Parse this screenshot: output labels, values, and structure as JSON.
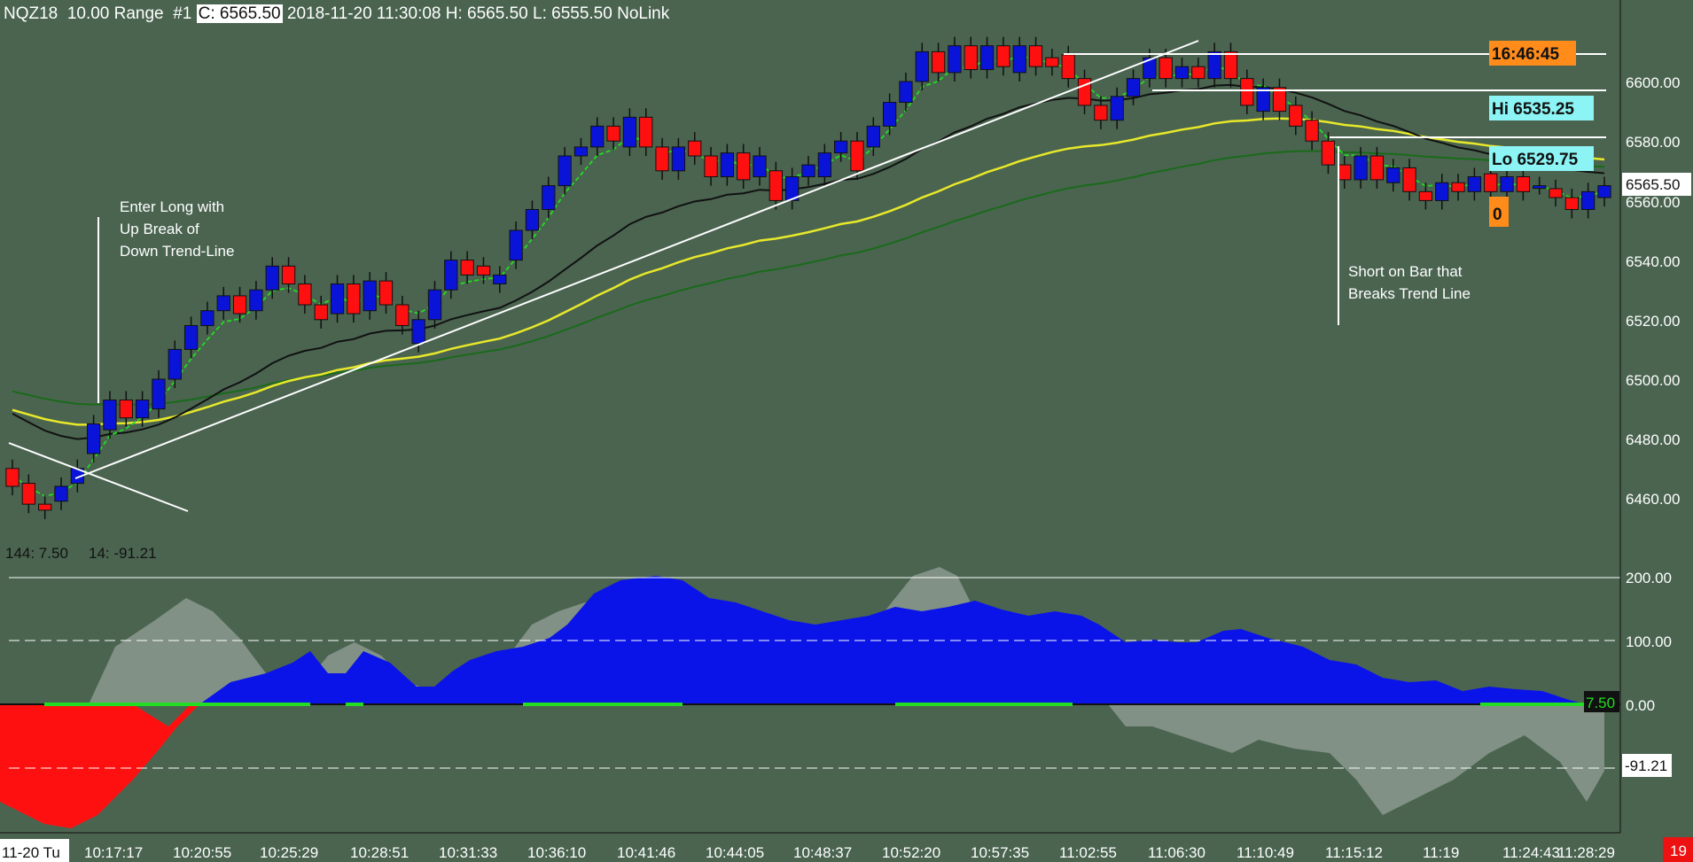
{
  "header": {
    "symbol": "NQZ18",
    "range": "10.00 Range",
    "chart_no": "#1",
    "close": "C: 6565.50",
    "datetime": "2018-11-20 11:30:08",
    "high": "H: 6565.50",
    "low": "L: 6555.50",
    "link": "NoLink"
  },
  "osc_label": {
    "a": "144: 7.50",
    "b": "14: -91.21"
  },
  "tags": {
    "clock": "16:46:45",
    "hi": "Hi 6535.25",
    "lo": "Lo 6529.75",
    "last_price": "6565.50",
    "bar_counter": "0",
    "osc_value": "7.50",
    "osc_value2": "-91.21",
    "corner": "19"
  },
  "annotations": {
    "long": [
      "Enter Long with",
      "Up Break of",
      "Down Trend-Line"
    ],
    "short": [
      "Short on Bar that",
      "Breaks Trend Line"
    ]
  },
  "colors": {
    "background": "#4a6450",
    "up_candle": "#0a14d8",
    "down_candle": "#ff1010",
    "ema_fast": "#22dd22",
    "ma_black": "#111111",
    "ma_yellow": "#e8e82a",
    "ma_green": "#1a6a1a",
    "clock_tag": "#ff8c1a",
    "hilo_tag": "#8cf4f4",
    "osc_blue": "#0a14e8",
    "osc_red": "#ff1010",
    "osc_zero_green": "#22dd22"
  },
  "chart_data": [
    {
      "type": "candlestick",
      "price_axis_ticks": [
        "6600.00",
        "6580.00",
        "6560.00",
        "6540.00",
        "6520.00",
        "6500.00",
        "6480.00",
        "6460.00"
      ],
      "ylim": [
        6444,
        6620
      ],
      "time_ticks": [
        "11-20 Tu",
        "10:17:17",
        "10:20:55",
        "10:25:29",
        "10:28:51",
        "10:31:33",
        "10:36:10",
        "10:41:46",
        "10:44:05",
        "10:48:37",
        "10:52:20",
        "10:57:35",
        "11:02:55",
        "11:06:30",
        "11:10:49",
        "11:15:12",
        "11:19",
        "11:24:43",
        "11:28:29"
      ],
      "candles": [
        {
          "o": 6470,
          "c": 6464
        },
        {
          "o": 6465,
          "c": 6458
        },
        {
          "o": 6458,
          "c": 6456
        },
        {
          "o": 6459,
          "c": 6464
        },
        {
          "o": 6465,
          "c": 6470
        },
        {
          "o": 6475,
          "c": 6485
        },
        {
          "o": 6483,
          "c": 6493
        },
        {
          "o": 6493,
          "c": 6487
        },
        {
          "o": 6487,
          "c": 6493
        },
        {
          "o": 6490,
          "c": 6500
        },
        {
          "o": 6500,
          "c": 6510
        },
        {
          "o": 6510,
          "c": 6518
        },
        {
          "o": 6518,
          "c": 6523
        },
        {
          "o": 6523,
          "c": 6528
        },
        {
          "o": 6528,
          "c": 6522
        },
        {
          "o": 6523,
          "c": 6530
        },
        {
          "o": 6530,
          "c": 6538
        },
        {
          "o": 6538,
          "c": 6532
        },
        {
          "o": 6532,
          "c": 6525
        },
        {
          "o": 6525,
          "c": 6520
        },
        {
          "o": 6522,
          "c": 6532
        },
        {
          "o": 6532,
          "c": 6522
        },
        {
          "o": 6523,
          "c": 6533
        },
        {
          "o": 6533,
          "c": 6525
        },
        {
          "o": 6525,
          "c": 6518
        },
        {
          "o": 6512,
          "c": 6520
        },
        {
          "o": 6520,
          "c": 6530
        },
        {
          "o": 6530,
          "c": 6540
        },
        {
          "o": 6540,
          "c": 6535
        },
        {
          "o": 6538,
          "c": 6535
        },
        {
          "o": 6532,
          "c": 6535
        },
        {
          "o": 6540,
          "c": 6550
        },
        {
          "o": 6550,
          "c": 6557
        },
        {
          "o": 6557,
          "c": 6565
        },
        {
          "o": 6565,
          "c": 6575
        },
        {
          "o": 6575,
          "c": 6578
        },
        {
          "o": 6578,
          "c": 6585
        },
        {
          "o": 6585,
          "c": 6580
        },
        {
          "o": 6578,
          "c": 6588
        },
        {
          "o": 6588,
          "c": 6578
        },
        {
          "o": 6578,
          "c": 6570
        },
        {
          "o": 6570,
          "c": 6578
        },
        {
          "o": 6580,
          "c": 6575
        },
        {
          "o": 6575,
          "c": 6568
        },
        {
          "o": 6568,
          "c": 6576
        },
        {
          "o": 6576,
          "c": 6567
        },
        {
          "o": 6568,
          "c": 6575
        },
        {
          "o": 6570,
          "c": 6560
        },
        {
          "o": 6560,
          "c": 6568
        },
        {
          "o": 6568,
          "c": 6572
        },
        {
          "o": 6568,
          "c": 6576
        },
        {
          "o": 6576,
          "c": 6580
        },
        {
          "o": 6580,
          "c": 6570
        },
        {
          "o": 6578,
          "c": 6585
        },
        {
          "o": 6585,
          "c": 6593
        },
        {
          "o": 6593,
          "c": 6600
        },
        {
          "o": 6600,
          "c": 6610
        },
        {
          "o": 6610,
          "c": 6603
        },
        {
          "o": 6603,
          "c": 6612
        },
        {
          "o": 6612,
          "c": 6604
        },
        {
          "o": 6604,
          "c": 6612
        },
        {
          "o": 6612,
          "c": 6605
        },
        {
          "o": 6603,
          "c": 6612
        },
        {
          "o": 6612,
          "c": 6605
        },
        {
          "o": 6608,
          "c": 6605
        },
        {
          "o": 6609,
          "c": 6601
        },
        {
          "o": 6601,
          "c": 6592
        },
        {
          "o": 6592,
          "c": 6587
        },
        {
          "o": 6587,
          "c": 6595
        },
        {
          "o": 6595,
          "c": 6601
        },
        {
          "o": 6601,
          "c": 6608
        },
        {
          "o": 6608,
          "c": 6601
        },
        {
          "o": 6601,
          "c": 6605
        },
        {
          "o": 6605,
          "c": 6601
        },
        {
          "o": 6601,
          "c": 6610
        },
        {
          "o": 6610,
          "c": 6601
        },
        {
          "o": 6601,
          "c": 6592
        },
        {
          "o": 6590,
          "c": 6598
        },
        {
          "o": 6598,
          "c": 6590
        },
        {
          "o": 6592,
          "c": 6585
        },
        {
          "o": 6587,
          "c": 6580
        },
        {
          "o": 6580,
          "c": 6572
        },
        {
          "o": 6572,
          "c": 6567
        },
        {
          "o": 6567,
          "c": 6575
        },
        {
          "o": 6575,
          "c": 6567
        },
        {
          "o": 6566,
          "c": 6571
        },
        {
          "o": 6571,
          "c": 6563
        },
        {
          "o": 6563,
          "c": 6560
        },
        {
          "o": 6560,
          "c": 6566
        },
        {
          "o": 6566,
          "c": 6563
        },
        {
          "o": 6563,
          "c": 6568
        },
        {
          "o": 6569,
          "c": 6563
        },
        {
          "o": 6563,
          "c": 6568
        },
        {
          "o": 6568,
          "c": 6563
        },
        {
          "o": 6565,
          "c": 6565
        },
        {
          "o": 6564,
          "c": 6561
        },
        {
          "o": 6561,
          "c": 6557
        },
        {
          "o": 6557,
          "c": 6563
        },
        {
          "o": 6561,
          "c": 6565
        }
      ]
    },
    {
      "type": "area",
      "axis_ticks": [
        "200.00",
        "100.00",
        "0.00"
      ],
      "ylim": [
        -150,
        210
      ]
    }
  ]
}
